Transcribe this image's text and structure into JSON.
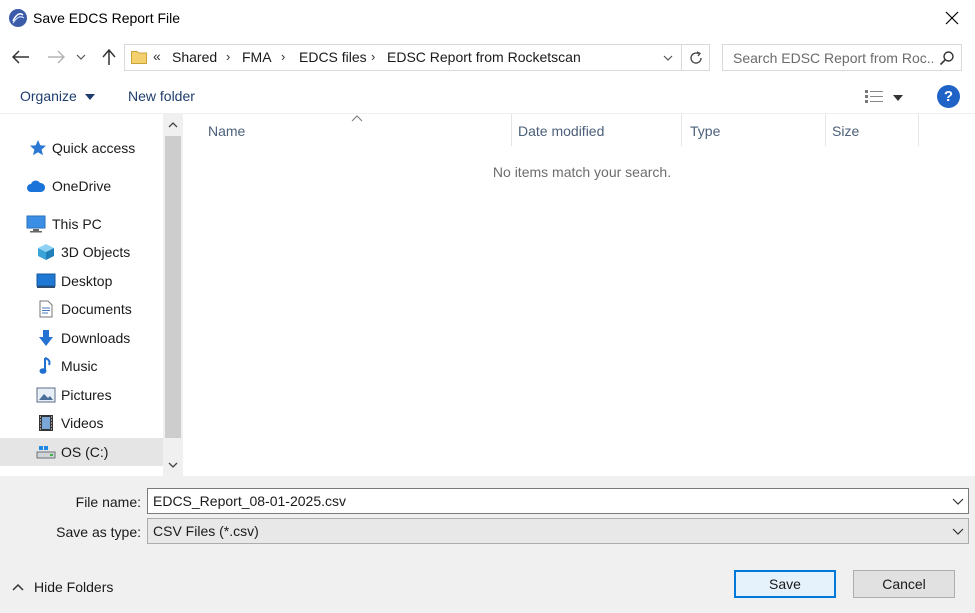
{
  "window": {
    "title": "Save EDCS Report File",
    "icon": "app-logo-icon"
  },
  "address": {
    "overflow_label": "«",
    "crumbs": [
      "Shared",
      "FMA",
      "EDCS files",
      "EDSC Report from Rocketscan"
    ],
    "separator": "›"
  },
  "search": {
    "placeholder": "Search EDSC Report from Roc..."
  },
  "toolbar": {
    "organize_label": "Organize",
    "new_folder_label": "New folder",
    "help_label": "?"
  },
  "navpane": {
    "items": [
      {
        "label": "Quick access",
        "icon": "star-icon",
        "level": 0
      },
      {
        "label": "OneDrive",
        "icon": "cloud-icon",
        "level": 0
      },
      {
        "label": "This PC",
        "icon": "computer-icon",
        "level": 0
      },
      {
        "label": "3D Objects",
        "icon": "cube-icon",
        "level": 1
      },
      {
        "label": "Desktop",
        "icon": "desktop-icon",
        "level": 1
      },
      {
        "label": "Documents",
        "icon": "document-icon",
        "level": 1
      },
      {
        "label": "Downloads",
        "icon": "download-arrow-icon",
        "level": 1
      },
      {
        "label": "Music",
        "icon": "music-note-icon",
        "level": 1
      },
      {
        "label": "Pictures",
        "icon": "picture-icon",
        "level": 1
      },
      {
        "label": "Videos",
        "icon": "film-icon",
        "level": 1
      },
      {
        "label": "OS (C:)",
        "icon": "drive-icon",
        "level": 1,
        "selected": true
      }
    ]
  },
  "filelist": {
    "columns": [
      "Name",
      "Date modified",
      "Type",
      "Size"
    ],
    "empty_message": "No items match your search."
  },
  "form": {
    "file_name_label": "File name:",
    "file_name_value": "EDCS_Report_08-01-2025.csv",
    "save_type_label": "Save as type:",
    "save_type_value": "CSV Files (*.csv)"
  },
  "footer": {
    "hide_folders_label": "Hide Folders",
    "save_label": "Save",
    "cancel_label": "Cancel"
  },
  "colors": {
    "accent": "#0078d7",
    "link": "#1e3d6e",
    "selected_bg": "#e5e5e5"
  }
}
